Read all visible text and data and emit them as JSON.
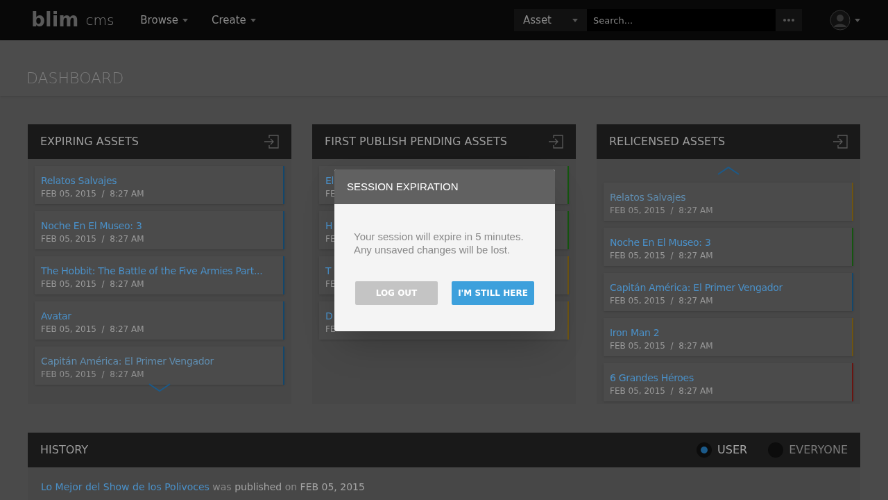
{
  "navbar": {
    "logo": "blim",
    "logo_suffix": "cms",
    "menus": [
      {
        "label": "Browse"
      },
      {
        "label": "Create"
      }
    ],
    "search": {
      "scope": "Asset",
      "placeholder": "Search..."
    }
  },
  "page_title": "DASHBOARD",
  "panels": [
    {
      "title": "EXPIRING ASSETS",
      "more_above": false,
      "more_below": true,
      "items": [
        {
          "title": "Relatos Salvajes",
          "date": "FEB 05, 2015  /  8:27 AM",
          "color": "#12476d",
          "faded": false
        },
        {
          "title": "Noche En El Museo: 3",
          "date": "FEB 05, 2015  /  8:27 AM",
          "color": "#12476d",
          "faded": false
        },
        {
          "title": "The Hobbit: The Battle of the Five Armies Part...",
          "date": "FEB 05, 2015  /  8:27 AM",
          "color": "#12476d",
          "faded": false
        },
        {
          "title": "Avatar",
          "date": "FEB 05, 2015  /  8:27 AM",
          "color": "#12476d",
          "faded": false
        },
        {
          "title": "Capitán América: El Primer Vengador",
          "date": "FEB 05, 2015  /  8:27 AM",
          "color": "#12476d",
          "faded": true
        }
      ]
    },
    {
      "title": "FIRST PUBLISH PENDING ASSETS",
      "more_above": false,
      "more_below": false,
      "items": [
        {
          "title": "El",
          "date": "FE",
          "color": "#14560f",
          "faded": false
        },
        {
          "title": "H",
          "date": "FE",
          "color": "#14560f",
          "faded": false
        },
        {
          "title": "T",
          "date": "FE",
          "color": "#6e5410",
          "faded": false
        },
        {
          "title": "D",
          "date": "FE",
          "color": "#6e5410",
          "faded": false
        }
      ]
    },
    {
      "title": "RELICENSED ASSETS",
      "more_above": true,
      "more_below": false,
      "items": [
        {
          "title": "Relatos Salvajes",
          "date": "FEB 05, 2015  /  8:27 AM",
          "color": "#6e5410",
          "faded": true
        },
        {
          "title": "Noche En El Museo: 3",
          "date": "FEB 05, 2015  /  8:27 AM",
          "color": "#14560f",
          "faded": false
        },
        {
          "title": "Capitán América: El Primer Vengador",
          "date": "FEB 05, 2015  /  8:27 AM",
          "color": "#12476d",
          "faded": false
        },
        {
          "title": "Iron Man 2",
          "date": "FEB 05, 2015  /  8:27 AM",
          "color": "#6e5410",
          "faded": false
        },
        {
          "title": "6 Grandes Héroes",
          "date": "FEB 05, 2015  /  8:27 AM",
          "color": "#6a1410",
          "faded": false
        }
      ]
    }
  ],
  "history": {
    "title": "HISTORY",
    "filters": [
      {
        "label": "USER",
        "selected": true
      },
      {
        "label": "EVERYONE",
        "selected": false
      }
    ],
    "entries": [
      {
        "parts": [
          {
            "kind": "link",
            "text": "Lo Mejor del Show de los Polivoces"
          },
          {
            "kind": "muted",
            "text": "was"
          },
          {
            "kind": "strong",
            "text": "published"
          },
          {
            "kind": "muted",
            "text": "on"
          },
          {
            "kind": "strong",
            "text": "FEB 05, 2015"
          }
        ]
      }
    ]
  },
  "modal": {
    "title": "SESSION EXPIRATION",
    "message": "Your session will expire in 5 minutes.\nAny unsaved changes will be lost.",
    "buttons": [
      {
        "label": "LOG OUT",
        "kind": "secondary"
      },
      {
        "label": "I'M STILL HERE",
        "kind": "primary"
      }
    ]
  }
}
